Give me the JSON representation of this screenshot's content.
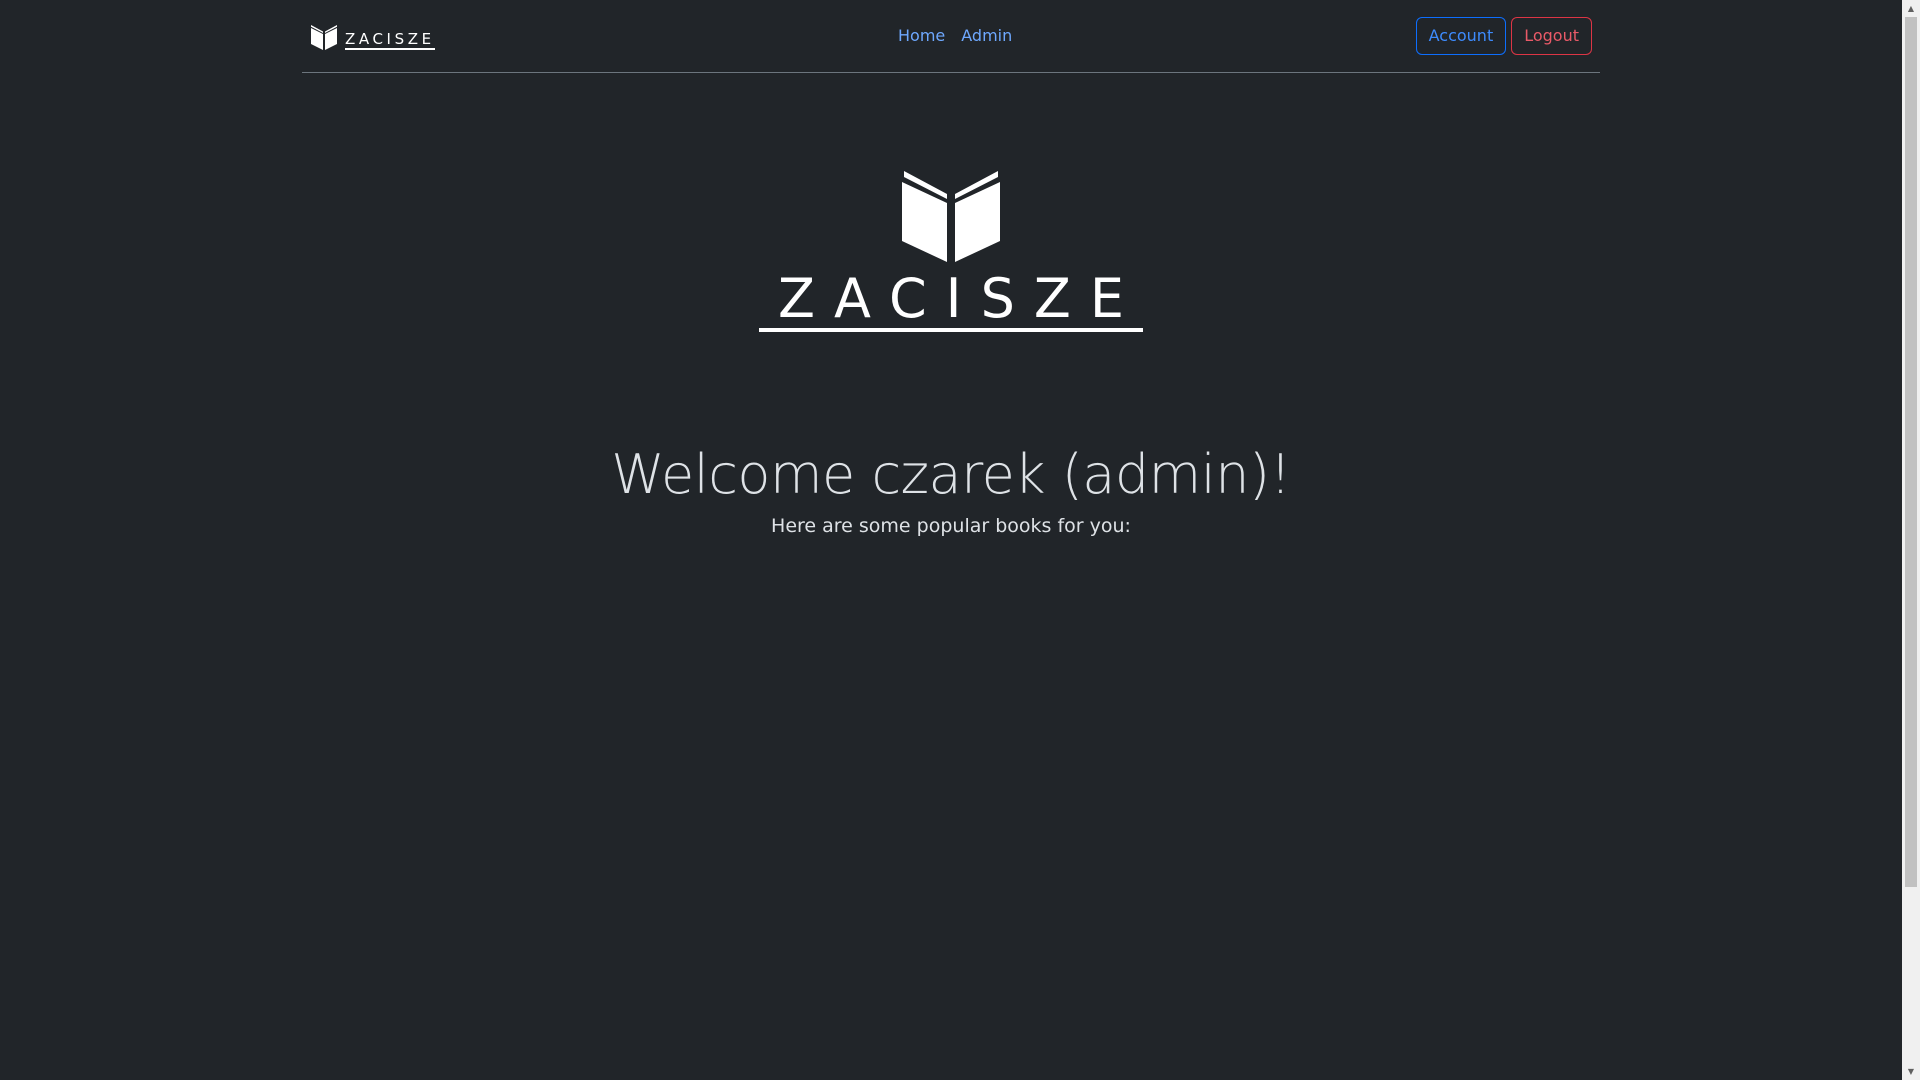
{
  "brand": {
    "name": "ZACISZE",
    "icon": "open-book-icon"
  },
  "nav": {
    "links": [
      {
        "label": "Home"
      },
      {
        "label": "Admin"
      }
    ],
    "account_label": "Account",
    "logout_label": "Logout"
  },
  "hero": {
    "logo_text": "ZACISZE",
    "icon": "open-book-icon"
  },
  "welcome": {
    "title": "Welcome czarek (admin)!",
    "subtitle": "Here are some popular books for you:"
  },
  "colors": {
    "background": "#212529",
    "link": "#6ea8fe",
    "account_border": "#0d6efd",
    "logout_border": "#dc3545"
  }
}
